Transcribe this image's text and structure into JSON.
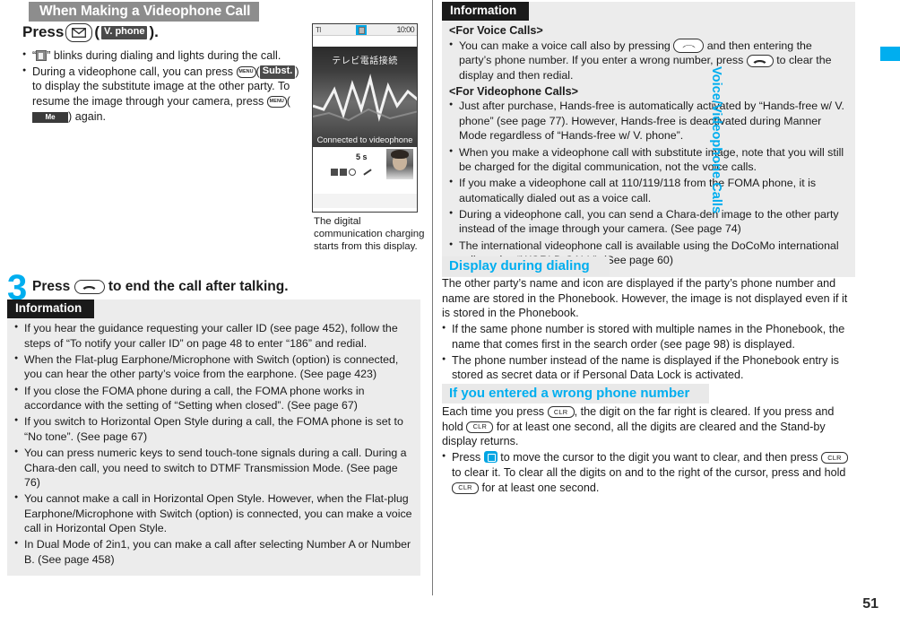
{
  "page": {
    "number": "51",
    "side_tab_label": "Voice/Videophone Calls",
    "accent_color": "#00aeef",
    "header_bar_color": "#8d8d8d",
    "info_header_color": "#1a1a1a",
    "info_box_bg": "#ececec"
  },
  "left": {
    "section_title": "When Making a Videophone Call",
    "press_line": {
      "prefix": "Press",
      "key_icon": "mail-key-icon",
      "paren_open": "(",
      "softkey_label": "V. phone",
      "paren_close": ").",
      "suffix": ")."
    },
    "bullets": [
      {
        "segments": [
          {
            "type": "text",
            "value": "“"
          },
          {
            "type": "icon",
            "value": "videophone-pictogram-icon"
          },
          {
            "type": "text",
            "value": "” blinks during dialing and lights during the call."
          }
        ],
        "plain": "“ ” blinks during dialing and lights during the call."
      },
      {
        "plain": "During a videophone call, you can press MENU ( Subst. ) to display the substitute image at the other party. To resume the image through your camera, press MENU ( Me ) again.",
        "part1": "During a videophone call, you can press",
        "softkey1": "Subst.",
        "part2": ") to display the substitute image at the other party. To resume the image through your camera, press",
        "softkey2": "Me",
        "part3": ") again."
      }
    ],
    "phone_shot": {
      "status_signal": "Tl",
      "status_clock": "10:00",
      "video_title_jp": "テレビ電話接続",
      "video_caption": "Connected to videophone",
      "timer": "5 s"
    },
    "phone_caption": "The digital communication charging starts from this display.",
    "step3": {
      "number": "3",
      "text_before": "Press",
      "key_icon": "end-call-key-icon",
      "text_after": "to end the call after talking."
    },
    "info": {
      "title": "Information",
      "bullets": [
        "If you hear the guidance requesting your caller ID (see page 452), follow the steps of “To notify your caller ID” on page 48 to enter “186” and redial.",
        "When the Flat-plug Earphone/Microphone with Switch (option) is connected, you can hear the other party’s voice from the earphone. (See page 423)",
        "If you close the FOMA phone during a call, the FOMA phone works in accordance with the setting of “Setting when closed”. (See page 67)",
        "If you switch to Horizontal Open Style during a call, the FOMA phone is set to “No tone”. (See page 67)",
        "You can press numeric keys to send touch-tone signals during a call. During a Chara-den call, you need to switch to DTMF Transmission Mode. (See page 76)",
        "You cannot make a call in Horizontal Open Style. However, when the Flat-plug Earphone/Microphone with Switch (option) is connected, you can make a voice call in Horizontal Open Style.",
        "In Dual Mode of 2in1, you can make a call after selecting Number A or Number B. (See page 458)"
      ]
    }
  },
  "right": {
    "info": {
      "title": "Information",
      "subhead_voice": "<For Voice Calls>",
      "voice_bullet": {
        "part1": "You can make a voice call also by pressing",
        "part2": "and then entering the party’s phone number. If you enter a wrong number, press",
        "part3": "to clear the display and then redial.",
        "plain": "You can make a voice call also by pressing (call key) and then entering the party’s phone number. If you enter a wrong number, press (end key) to clear the display and then redial."
      },
      "subhead_video": "<For Videophone Calls>",
      "video_bullets": [
        "Just after purchase, Hands-free is automatically activated by “Hands-free w/ V. phone” (see page 77). However, Hands-free is deactivated during Manner Mode regardless of “Hands-free w/ V. phone”.",
        "When you make a videophone call with substitute image, note that you will still be charged for the digital communication, not the voice calls.",
        "If you make a videophone call at 110/119/118 from the FOMA phone, it is automatically dialed out as a voice call.",
        "During a videophone call, you can send a Chara-den image to the other party instead of the image through your camera. (See page 74)",
        "The international videophone call is available using the DoCoMo international call service “WORLD CALL”. (See page 60)"
      ]
    },
    "display_dialing": {
      "title": "Display during dialing",
      "paragraph": "The other party’s name and icon are displayed if the party’s phone number and name are stored in the Phonebook. However, the image is not displayed even if it is stored in the Phonebook.",
      "bullets": [
        "If the same phone number is stored with multiple names in the Phonebook, the name that comes first in the search order (see page 98) is displayed.",
        "The phone number instead of the name is displayed if the Phonebook entry is stored as secret data or if Personal Data Lock is activated."
      ]
    },
    "wrong_number": {
      "title": "If you entered a wrong phone number",
      "paragraph": {
        "part1": "Each time you press",
        "key1": "CLR",
        "part2": ", the digit on the far right is cleared. If you press and hold",
        "key2": "CLR",
        "part3": "for at least one second, all the digits are cleared and the Stand-by display returns.",
        "plain": "Each time you press CLR, the digit on the far right is cleared. If you press and hold CLR for at least one second, all the digits are cleared and the Stand-by display returns."
      },
      "bullet": {
        "part1": "Press",
        "part2": "to move the cursor to the digit you want to clear, and then press",
        "key1": "CLR",
        "part3": "to clear it. To clear all the digits on and to the right of the cursor, press and hold",
        "key2": "CLR",
        "part4": "for at least one second.",
        "plain": "Press (cursor key) to move the cursor to the digit you want to clear, and then press CLR to clear it. To clear all the digits on and to the right of the cursor, press and hold CLR for at least one second."
      }
    }
  }
}
